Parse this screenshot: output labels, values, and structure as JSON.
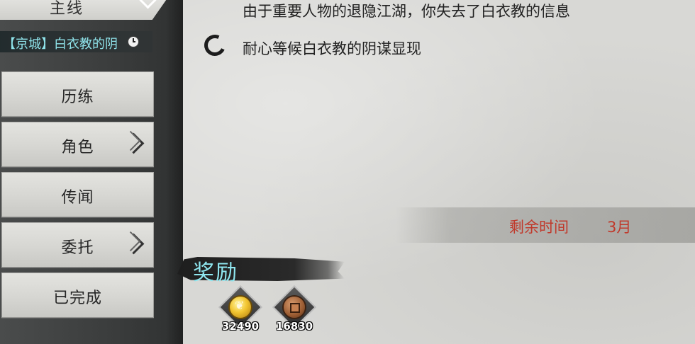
{
  "sidebar": {
    "top_tab_label": "主线",
    "quest_title": "【京城】白衣教的阴",
    "items": [
      {
        "label": "历练",
        "has_arrow": false
      },
      {
        "label": "角色",
        "has_arrow": true
      },
      {
        "label": "传闻",
        "has_arrow": false
      },
      {
        "label": "委托",
        "has_arrow": true
      },
      {
        "label": "已完成",
        "has_arrow": false
      }
    ]
  },
  "main": {
    "info_text": "由于重要人物的退隐江湖，你失去了白衣教的信息",
    "task_text": "耐心等候白衣教的阴谋显现",
    "time_label": "剩余时间",
    "time_value": "3月"
  },
  "rewards": {
    "title": "奖励",
    "items": [
      {
        "icon": "gold-ingot-icon",
        "count": "32490"
      },
      {
        "icon": "copper-coin-icon",
        "count": "16830"
      }
    ]
  },
  "colors": {
    "accent_cyan": "#8fe3ea",
    "time_red": "#c0392b",
    "text_dark": "#222222"
  }
}
